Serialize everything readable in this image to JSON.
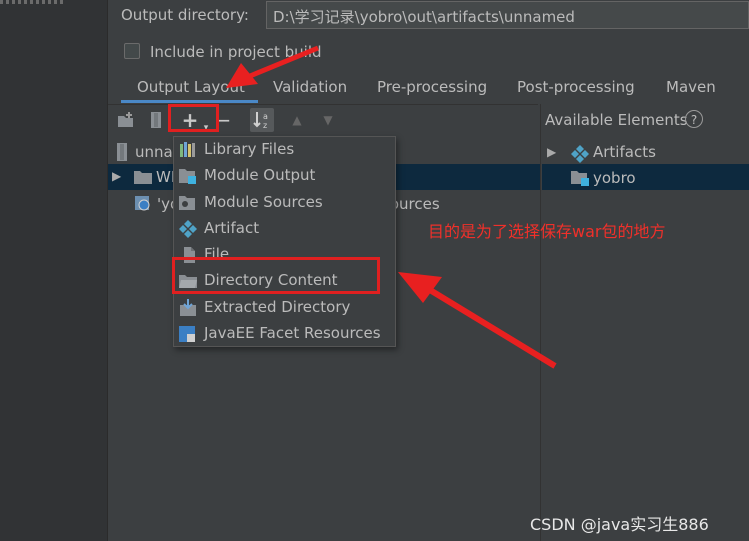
{
  "settings": {
    "output_dir_label": "Output directory:",
    "output_dir_value": "D:\\学习记录\\yobro\\out\\artifacts\\unnamed",
    "include_label": "Include in project build"
  },
  "tabs": [
    {
      "label": "Output Layout"
    },
    {
      "label": "Validation"
    },
    {
      "label": "Pre-processing"
    },
    {
      "label": "Post-processing"
    },
    {
      "label": "Maven"
    }
  ],
  "available": {
    "title": "Available Elements",
    "items": [
      {
        "label": "Artifacts"
      },
      {
        "label": "yobro"
      }
    ]
  },
  "tree": {
    "root_label": "unnamed",
    "web_label": "WEB-INF",
    "resources_label": "'yobro' module: 'Web' facet resources"
  },
  "menu": {
    "items": [
      {
        "label": "Library Files"
      },
      {
        "label": "Module Output"
      },
      {
        "label": "Module Sources"
      },
      {
        "label": "Artifact"
      },
      {
        "label": "File"
      },
      {
        "label": "Directory Content"
      },
      {
        "label": "Extracted Directory"
      },
      {
        "label": "JavaEE Facet Resources"
      }
    ]
  },
  "annotation": "目的是为了选择保存war包的地方",
  "watermark": "CSDN @java实习生886",
  "colors": {
    "accent": "#4a88c7",
    "annotation_red": "#e02020",
    "selection": "#0d293e"
  }
}
